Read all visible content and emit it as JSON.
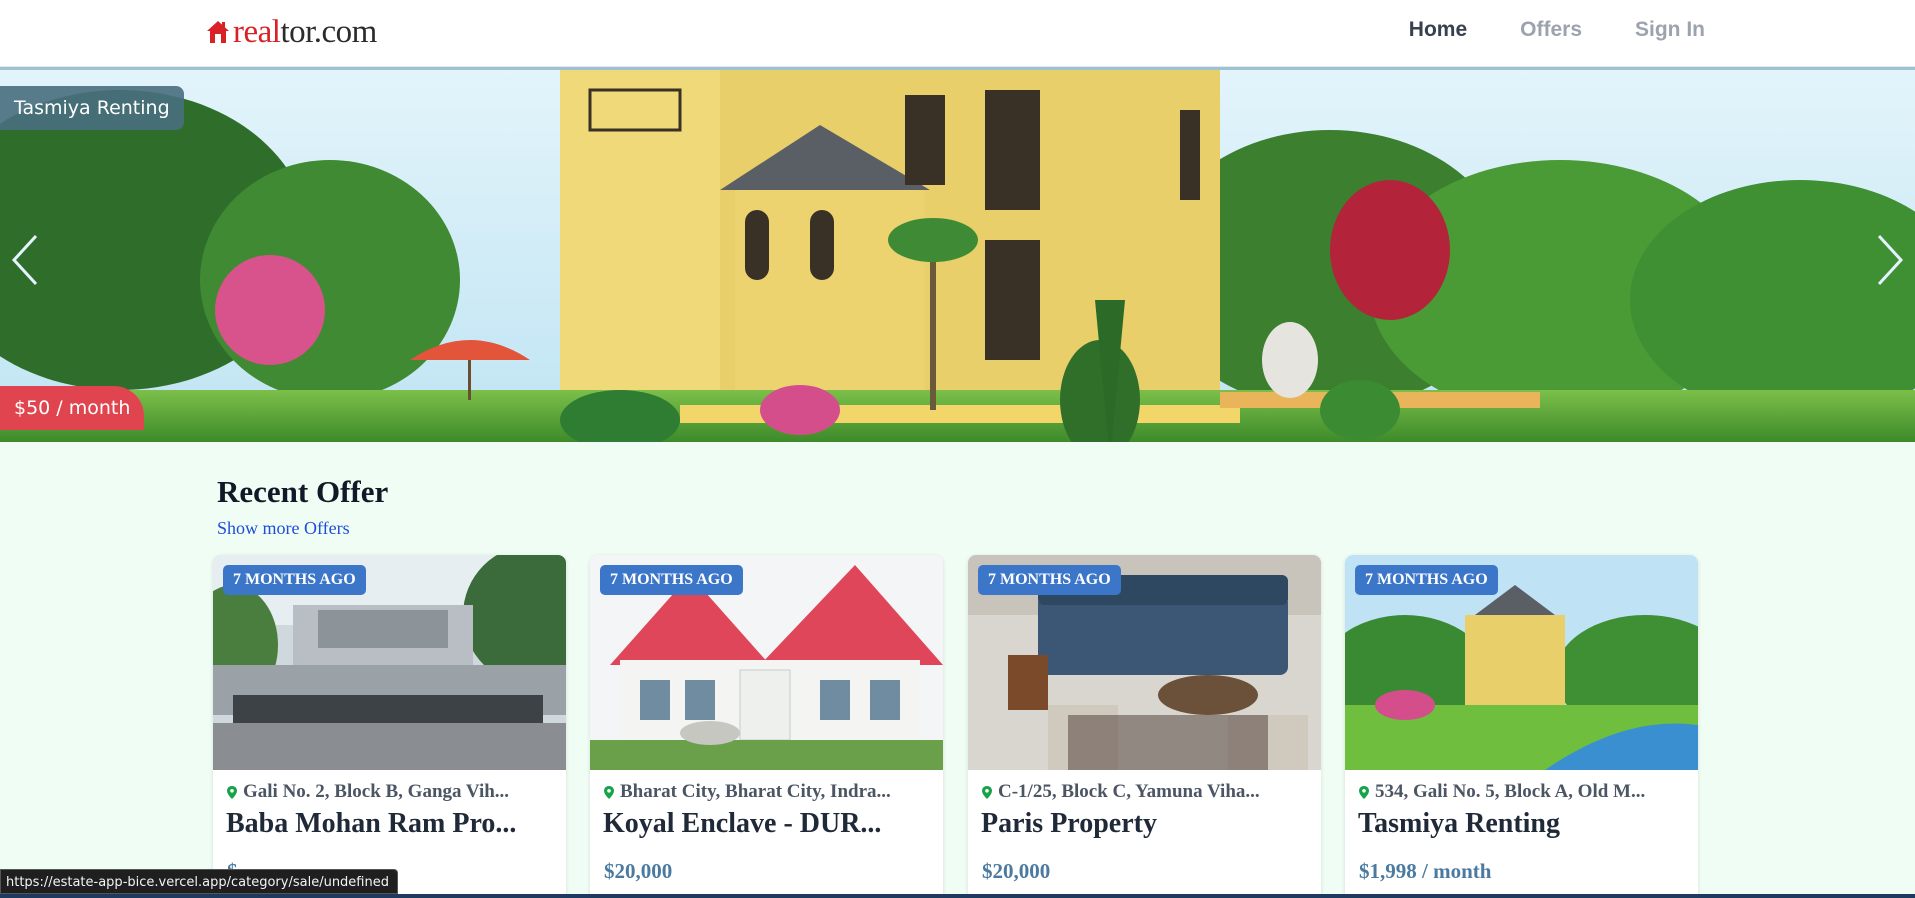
{
  "header": {
    "logo": {
      "text_red": "real",
      "text_dark": "tor.com",
      "icon": "house-icon"
    },
    "nav": [
      {
        "label": "Home",
        "active": true
      },
      {
        "label": "Offers",
        "active": false
      },
      {
        "label": "Sign In",
        "active": false
      }
    ]
  },
  "hero": {
    "title": "Tasmiya Renting",
    "price": "$50 / month",
    "prev_icon": "chevron-left-icon",
    "next_icon": "chevron-right-icon"
  },
  "recent": {
    "title": "Recent Offer",
    "show_more": "Show more Offers",
    "cards": [
      {
        "badge": "7 MONTHS AGO",
        "address": "Gali No. 2, Block B, Ganga Vih...",
        "name": "Baba Mohan Ram Pro...",
        "price": "$"
      },
      {
        "badge": "7 MONTHS AGO",
        "address": "Bharat City, Bharat City, Indra...",
        "name": "Koyal Enclave - DUR...",
        "price": "$20,000"
      },
      {
        "badge": "7 MONTHS AGO",
        "address": "C-1/25, Block C, Yamuna Viha...",
        "name": "Paris Property",
        "price": "$20,000"
      },
      {
        "badge": "7 MONTHS AGO",
        "address": "534, Gali No. 5, Block A, Old M...",
        "name": "Tasmiya Renting",
        "price": "$1,998 / month"
      }
    ]
  },
  "status_bar": {
    "url": "https://estate-app-bice.vercel.app/category/sale/undefined"
  },
  "colors": {
    "brand_red": "#d92228",
    "badge_blue": "#3b76c9",
    "price_blue": "#4b7aa1",
    "page_bg": "#f0fdf4"
  }
}
